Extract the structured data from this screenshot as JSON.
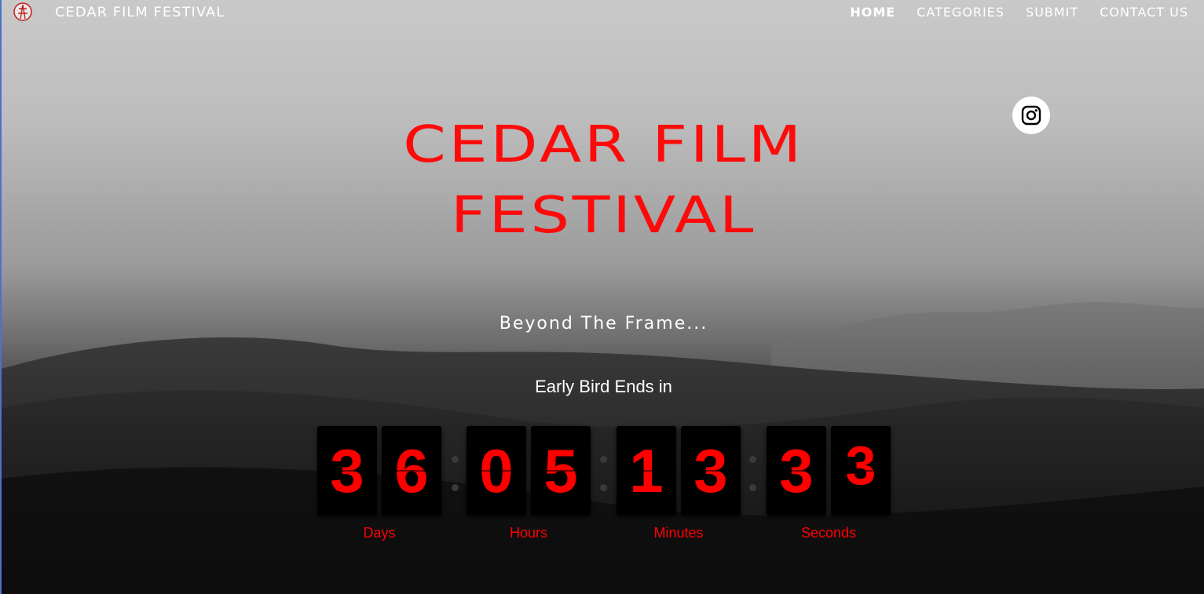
{
  "header": {
    "site_name": "CEDAR FILM FESTIVAL",
    "nav": [
      {
        "label": "HOME",
        "active": true
      },
      {
        "label": "CATEGORIES",
        "active": false
      },
      {
        "label": "SUBMIT",
        "active": false
      },
      {
        "label": "CONTACT US",
        "active": false
      }
    ]
  },
  "hero": {
    "title_line1": "CEDAR FILM",
    "title_line2": "FESTIVAL",
    "tagline": "Beyond The Frame...",
    "countdown_heading": "Early Bird Ends in"
  },
  "countdown": {
    "days": [
      "3",
      "6"
    ],
    "hours": [
      "0",
      "5"
    ],
    "minutes": [
      "1",
      "3"
    ],
    "seconds": [
      "3",
      "3"
    ],
    "labels": {
      "days": "Days",
      "hours": "Hours",
      "minutes": "Minutes",
      "seconds": "Seconds"
    }
  },
  "social": {
    "instagram_icon": "instagram-icon"
  },
  "colors": {
    "accent": "#ff0a0a",
    "digit_bg": "#000000",
    "nav_text": "#ffffff"
  }
}
